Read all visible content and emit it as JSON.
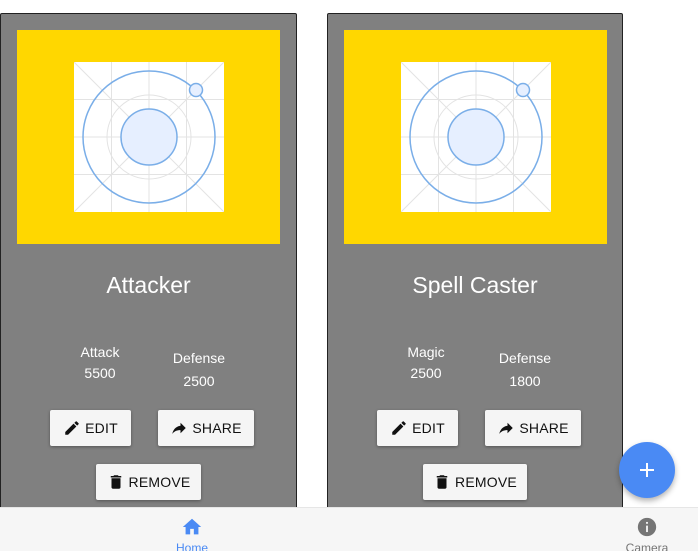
{
  "colors": {
    "card_bg": "#808080",
    "image_bg": "#FFD700",
    "accent": "#4A8AF4",
    "inactive": "#757575"
  },
  "cards": [
    {
      "title": "Attacker",
      "stat1_label": "Attack",
      "stat1_value": "5500",
      "stat2_label": "Defense",
      "stat2_value": "2500",
      "edit_label": "EDIT",
      "share_label": "SHARE",
      "remove_label": "REMOVE"
    },
    {
      "title": "Spell Caster",
      "stat1_label": "Magic",
      "stat1_value": "2500",
      "stat2_label": "Defense",
      "stat2_value": "1800",
      "edit_label": "EDIT",
      "share_label": "SHARE",
      "remove_label": "REMOVE"
    }
  ],
  "fab": {
    "icon": "plus-icon"
  },
  "bottom_nav": {
    "items": [
      {
        "label": "Home",
        "icon": "home-icon",
        "active": true
      },
      {
        "label": "Camera",
        "icon": "info-icon",
        "active": false
      }
    ]
  }
}
